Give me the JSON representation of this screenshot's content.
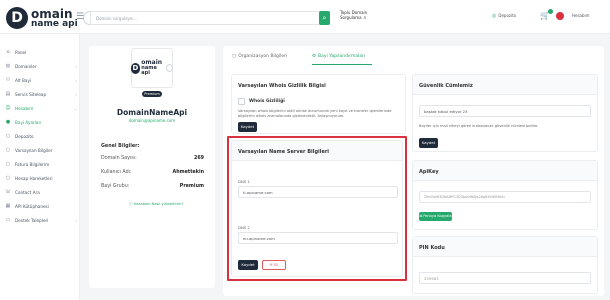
{
  "brand": {
    "mark": "D",
    "line1": "omain",
    "line2": "name api"
  },
  "search": {
    "placeholder": "Domain sorgulayın...",
    "icon": "search-icon"
  },
  "bulk_query": {
    "line1": "Toplu Domain",
    "line2": "Sorgulama"
  },
  "topright": {
    "balance": "Depozito",
    "user": "Hesabım"
  },
  "colors": {
    "accent": "#26a96c",
    "dark": "#1f2b3a",
    "danger": "#d9313e"
  },
  "sidebar": {
    "items": [
      {
        "label": "Panel",
        "icon": "home-icon"
      },
      {
        "label": "Domainler",
        "icon": "globe-icon"
      },
      {
        "label": "Alt Bayi",
        "icon": "users-icon"
      },
      {
        "label": "Servis Siteleap",
        "icon": "server-icon"
      },
      {
        "label": "Hesabım",
        "icon": "user-icon"
      },
      {
        "label": "Bayi Ayarları",
        "icon": "dot-icon"
      },
      {
        "label": "Depozito",
        "icon": "dot-icon"
      },
      {
        "label": "Varsayılan Bilgiler",
        "icon": "dot-icon"
      },
      {
        "label": "Fatura Bilgilerim",
        "icon": "dot-icon"
      },
      {
        "label": "Hesap Hareketleri",
        "icon": "dot-icon"
      },
      {
        "label": "Contact Ara",
        "icon": "phone-icon"
      },
      {
        "label": "API Kütüphanesi",
        "icon": "grid-icon"
      },
      {
        "label": "Destek Talepleri",
        "icon": "ticket-icon"
      }
    ]
  },
  "profile": {
    "premium_badge": "Premium",
    "name": "DomainNameApi",
    "email": "domain@apiname.com",
    "general_title": "Genel Bilgiler:",
    "rows": [
      {
        "label": "Domain Sayısı:",
        "value": "269"
      },
      {
        "label": "Kullanıcı Adı:",
        "value": "Ahmettekin"
      },
      {
        "label": "Bayi Grubu:",
        "value": "Premium"
      }
    ],
    "upgrade_hint": "Hesabımı Nasıl yükseltirim?"
  },
  "tabs": [
    {
      "label": "Organizasyon Bilgileri"
    },
    {
      "label": "Bayi Yapılandırmaları"
    }
  ],
  "whois": {
    "title": "Varsayılan Whois Gizlilik Bilgisi",
    "checkbox_label": "Whois Gizliliği",
    "description": "Varsayılan whois bilgilerini aktif olmak durumunda yeni kayıt ve transfer işlemlerinde bilgilerim whois aramalarında gizlenecektir. Anlaşmıyorum.",
    "save": "Kaydet"
  },
  "security": {
    "title": "Güvenlik Cümlemiz",
    "value": "baştak kabul ediyor 23",
    "description": "Bayiler için mail sifreyi gören kullanılacak güvenlik cümlesi belirle.",
    "save": "Kaydet"
  },
  "ns": {
    "title": "Varsayılan Name Server Bilgileri",
    "dns1_label": "DNS 1",
    "dns1_value": "ti.apiname.com",
    "dns2_label": "DNS 2",
    "dns2_value": "eu.apiname.com",
    "save": "Kaydet",
    "delete": "Sil"
  },
  "apikey": {
    "title": "ApiKey",
    "value": "29bf4a9f3D6AMPC3D3bw0W6jq28gNYkN5Mb5c",
    "copy": "Panoya Kopyala"
  },
  "pin": {
    "title": "PIN Kodu",
    "value": "255983"
  }
}
